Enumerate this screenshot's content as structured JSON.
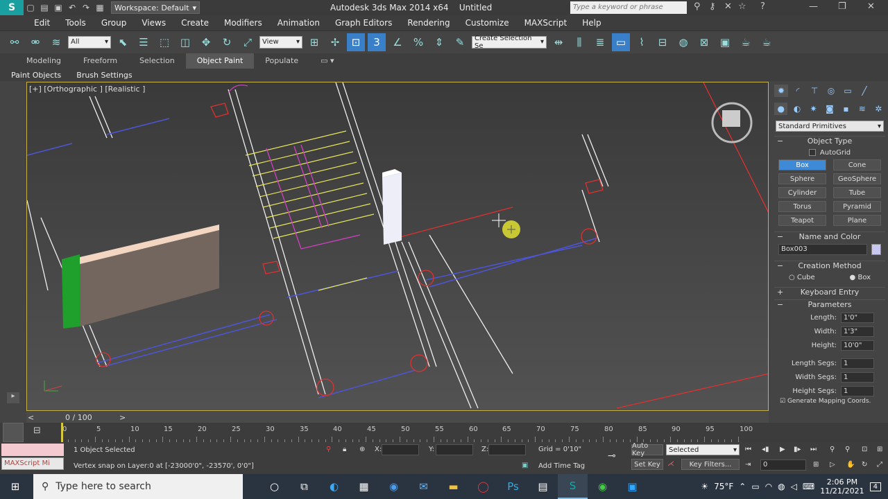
{
  "titlebar": {
    "workspace": "Workspace: Default",
    "title": "Autodesk 3ds Max  2014 x64",
    "doc": "Untitled",
    "search_placeholder": "Type a keyword or phrase"
  },
  "menu": [
    "Edit",
    "Tools",
    "Group",
    "Views",
    "Create",
    "Modifiers",
    "Animation",
    "Graph Editors",
    "Rendering",
    "Customize",
    "MAXScript",
    "Help"
  ],
  "toolbar": {
    "filter": "All",
    "refcoord": "View",
    "snap_label": "3",
    "named_selection": "Create Selection Se"
  },
  "ribbon": {
    "tabs": [
      "Modeling",
      "Freeform",
      "Selection",
      "Object Paint",
      "Populate"
    ],
    "active_tab": "Object Paint",
    "subtabs": [
      "Paint Objects",
      "Brush Settings"
    ]
  },
  "viewport": {
    "label": "[+] [Orthographic ] [Realistic ]"
  },
  "cmdpanel": {
    "category": "Standard Primitives",
    "object_type_title": "Object Type",
    "autogrid": "AutoGrid",
    "buttons": [
      "Box",
      "Cone",
      "Sphere",
      "GeoSphere",
      "Cylinder",
      "Tube",
      "Torus",
      "Pyramid",
      "Teapot",
      "Plane"
    ],
    "active_button": "Box",
    "name_color_title": "Name and Color",
    "object_name": "Box003",
    "object_color": "#c8c8f0",
    "creation_method_title": "Creation Method",
    "creation_cube": "Cube",
    "creation_box": "Box",
    "keyboard_entry_title": "Keyboard Entry",
    "parameters_title": "Parameters",
    "params": [
      {
        "label": "Length:",
        "value": "1'0\""
      },
      {
        "label": "Width:",
        "value": "1'3\""
      },
      {
        "label": "Height:",
        "value": "10'0\""
      }
    ],
    "segs": [
      {
        "label": "Length Segs:",
        "value": "1"
      },
      {
        "label": "Width Segs:",
        "value": "1"
      },
      {
        "label": "Height Segs:",
        "value": "1"
      }
    ],
    "gen_mapping": "Generate Mapping Coords."
  },
  "timeline": {
    "frame": "0 / 100",
    "ticks": [
      "0",
      "5",
      "10",
      "15",
      "20",
      "25",
      "30",
      "35",
      "40",
      "45",
      "50",
      "55",
      "60",
      "65",
      "70",
      "75",
      "80",
      "85",
      "90",
      "95",
      "100"
    ]
  },
  "status": {
    "maxscript": "MAXScript Mi",
    "selected": "1 Object Selected",
    "prompt": "Vertex snap on Layer:0 at [-23000'0\", -23570', 0'0\"]",
    "x_label": "X:",
    "y_label": "Y:",
    "z_label": "Z:",
    "grid": "Grid = 0'10\"",
    "autokey": "Auto Key",
    "autokey_mode": "Selected",
    "setkey": "Set Key",
    "key_filters": "Key Filters...",
    "add_time_tag": "Add Time Tag",
    "current_frame": "0"
  },
  "taskbar": {
    "search": "Type here to search",
    "weather": "75°F",
    "time": "2:06 PM",
    "date": "11/21/2021",
    "notif": "4"
  }
}
